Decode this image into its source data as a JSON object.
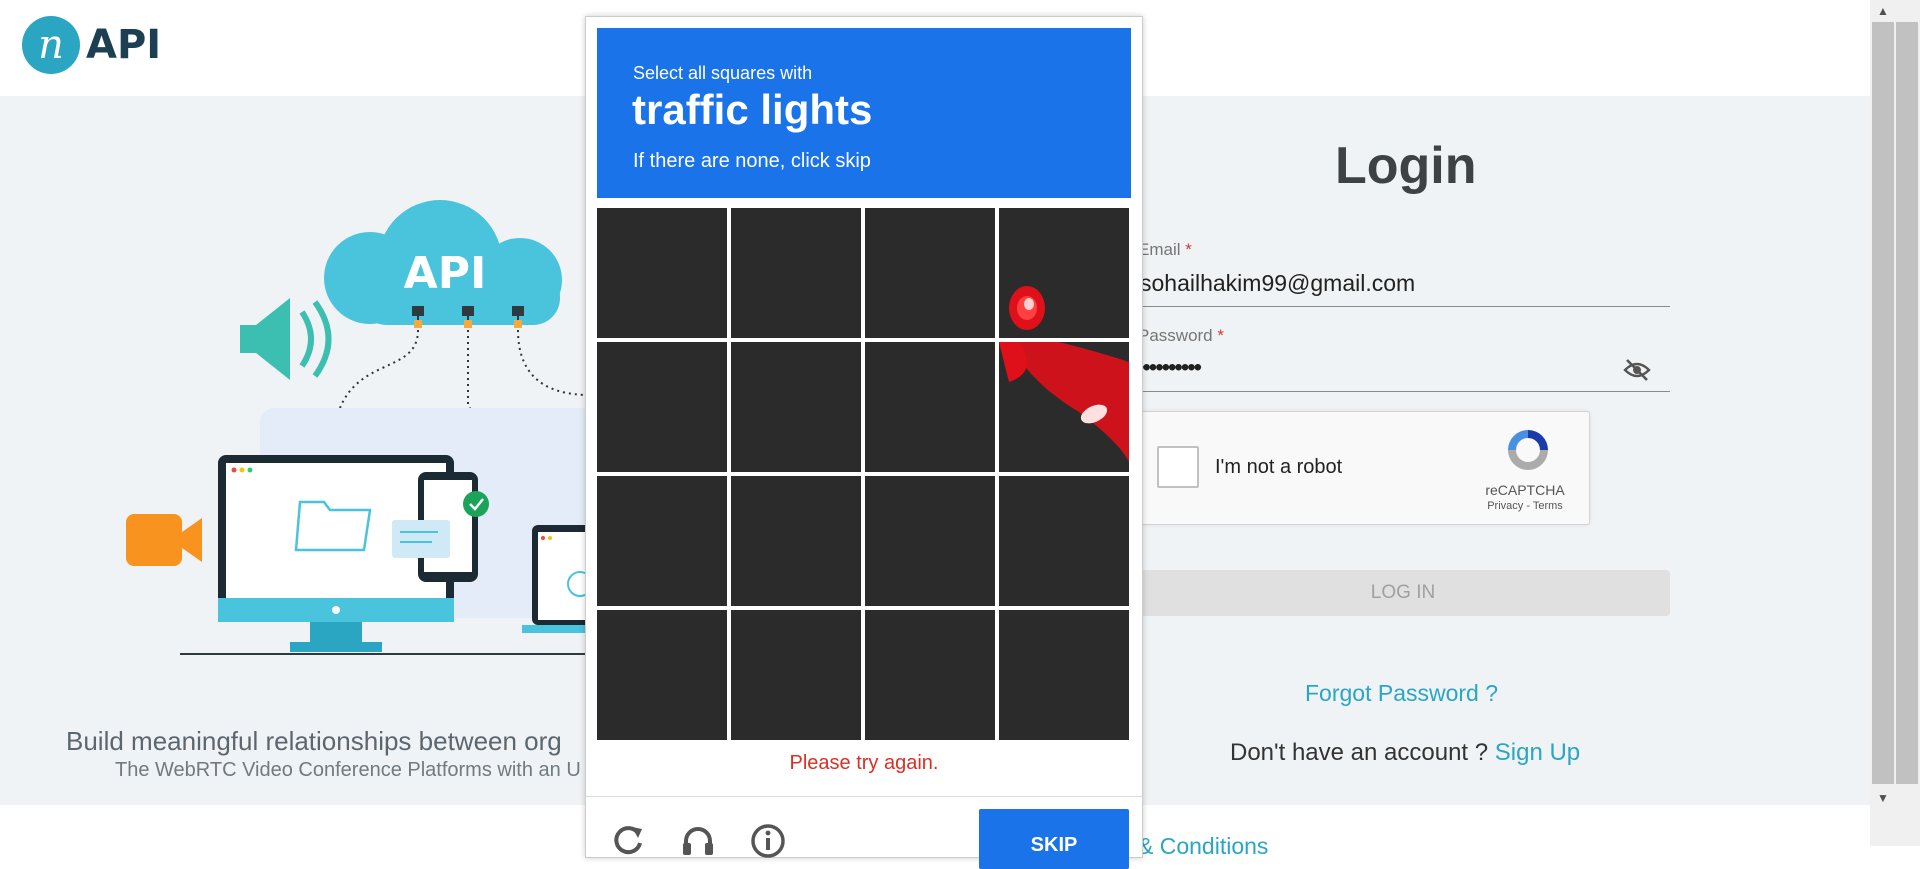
{
  "header": {
    "logo_letter": "n",
    "logo_text": "API"
  },
  "hero": {
    "cloud_label": "API",
    "tagline": "Build meaningful relationships between org",
    "subtagline": "The WebRTC Video Conference Platforms with an U"
  },
  "login": {
    "title": "Login",
    "email_label": "Email",
    "email_value": "sohailhakim99@gmail.com",
    "password_label": "Password",
    "password_value": "••••••••••",
    "required_mark": "*",
    "login_button": "LOG IN",
    "forgot_password": "Forgot Password ?",
    "no_account_text": "Don't have an account ?",
    "sign_up": "Sign Up",
    "terms_partial": "& Conditions"
  },
  "recaptcha": {
    "checkbox_label": "I'm not a robot",
    "brand": "reCAPTCHA",
    "privacy": "Privacy",
    "separator": "-",
    "terms": "Terms"
  },
  "challenge": {
    "instruction_line1": "Select all squares with",
    "target_object": "traffic lights",
    "instruction_line3": "If there are none, click skip",
    "grid_rows": 4,
    "grid_cols": 4,
    "error_message": "Please try again.",
    "skip_button": "SKIP",
    "accent_color": "#1a73e8",
    "error_color": "#d93025"
  },
  "colors": {
    "brand": "#2aa6c3",
    "link": "#2aa6c3"
  }
}
